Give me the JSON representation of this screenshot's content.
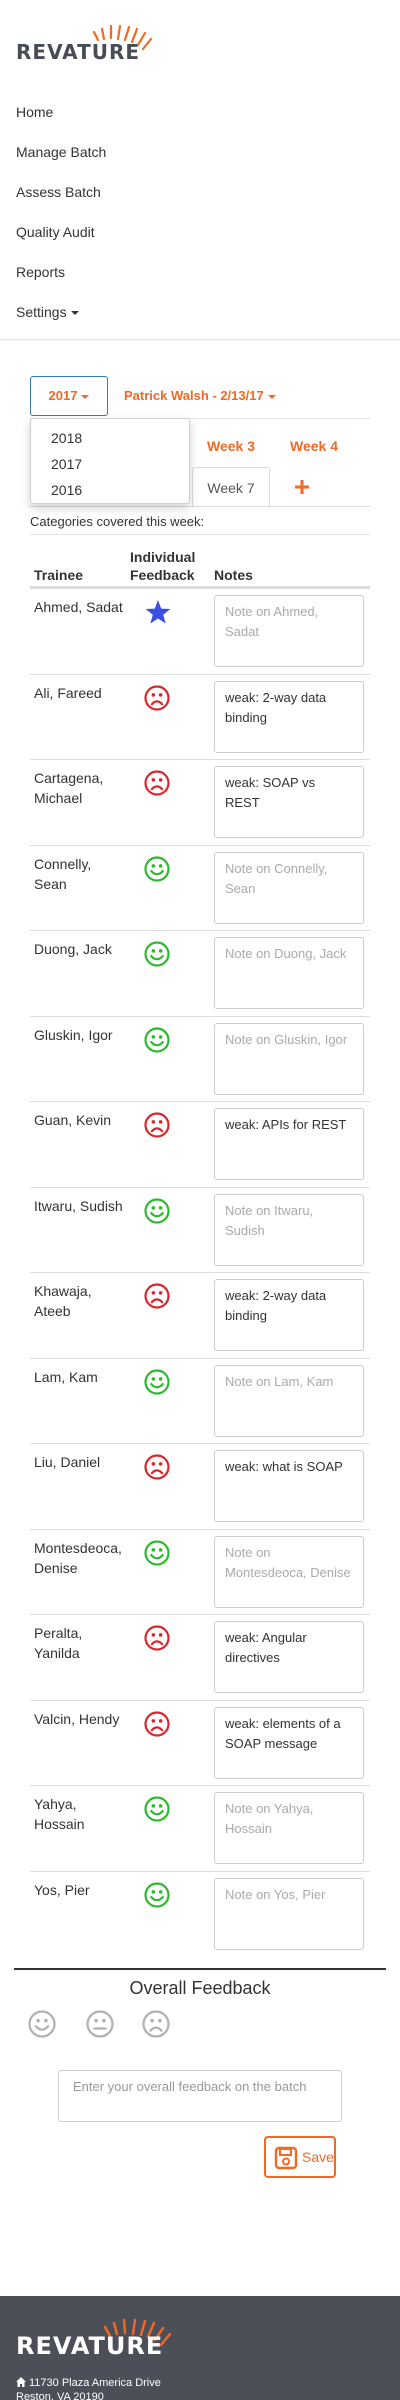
{
  "brand": {
    "name": "REVATURE",
    "accent_color": "#f26925",
    "footer_bg": "#4d4f58"
  },
  "nav": {
    "items": [
      {
        "label": "Home"
      },
      {
        "label": "Manage Batch"
      },
      {
        "label": "Assess Batch"
      },
      {
        "label": "Quality Audit"
      },
      {
        "label": "Reports"
      },
      {
        "label": "Settings"
      }
    ]
  },
  "selectors": {
    "year": "2017",
    "batch": "Patrick Walsh - 2/13/17",
    "year_options": [
      "2018",
      "2017",
      "2016"
    ]
  },
  "weeks": {
    "tabs": [
      "Week 3",
      "Week 4",
      "Week 7"
    ],
    "active": "Week 7",
    "add_icon": "plus-icon"
  },
  "categories_text": "Categories covered this week:",
  "table": {
    "headers": {
      "trainee": "Trainee",
      "feedback": "Individual Feedback",
      "notes": "Notes"
    },
    "rows": [
      {
        "name": "Ahmed, Sadat",
        "feedback": "star",
        "note": "",
        "placeholder": "Note on Ahmed, Sadat"
      },
      {
        "name": "Ali, Fareed",
        "feedback": "sad",
        "note": "weak: 2-way data binding",
        "placeholder": ""
      },
      {
        "name": "Cartagena, Michael",
        "feedback": "sad",
        "note": "weak: SOAP vs REST",
        "placeholder": ""
      },
      {
        "name": "Connelly, Sean",
        "feedback": "smile",
        "note": "",
        "placeholder": "Note on Connelly, Sean"
      },
      {
        "name": "Duong, Jack",
        "feedback": "smile",
        "note": "",
        "placeholder": "Note on Duong, Jack"
      },
      {
        "name": "Gluskin, Igor",
        "feedback": "smile",
        "note": "",
        "placeholder": "Note on Gluskin, Igor"
      },
      {
        "name": "Guan, Kevin",
        "feedback": "sad",
        "note": "weak: APIs for REST",
        "placeholder": ""
      },
      {
        "name": "Itwaru, Sudish",
        "feedback": "smile",
        "note": "",
        "placeholder": "Note on Itwaru, Sudish"
      },
      {
        "name": "Khawaja, Ateeb",
        "feedback": "sad",
        "note": "weak: 2-way data binding",
        "placeholder": ""
      },
      {
        "name": "Lam, Kam",
        "feedback": "smile",
        "note": "",
        "placeholder": "Note on Lam, Kam"
      },
      {
        "name": "Liu, Daniel",
        "feedback": "sad",
        "note": "weak: what is SOAP",
        "placeholder": ""
      },
      {
        "name": "Montesdeoca, Denise",
        "feedback": "smile",
        "note": "",
        "placeholder": "Note on Montesdeoca, Denise"
      },
      {
        "name": "Peralta, Yanilda",
        "feedback": "sad",
        "note": "weak: Angular directives",
        "placeholder": ""
      },
      {
        "name": "Valcin, Hendy",
        "feedback": "sad",
        "note": "weak: elements of a SOAP message",
        "placeholder": ""
      },
      {
        "name": "Yahya, Hossain",
        "feedback": "smile",
        "note": "",
        "placeholder": "Note on Yahya, Hossain"
      },
      {
        "name": "Yos, Pier",
        "feedback": "smile",
        "note": "",
        "placeholder": "Note on Yos, Pier"
      }
    ]
  },
  "feedback_colors": {
    "star": "#3b4fe0",
    "sad": "#d9262c",
    "smile": "#2eb82e",
    "neutral": "#b0b0b0"
  },
  "overall": {
    "title": "Overall Feedback",
    "faces": [
      "smile",
      "neutral",
      "sad"
    ],
    "placeholder": "Enter your overall feedback on the batch",
    "save_label": "Save"
  },
  "footer": {
    "brand": "REVATURE",
    "address_line1": "11730 Plaza America Drive",
    "address_line2": "Reston, VA 20190"
  }
}
